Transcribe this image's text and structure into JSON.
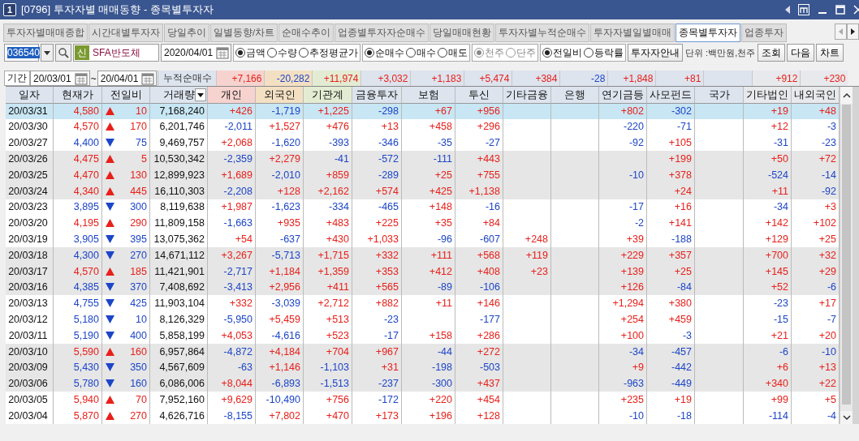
{
  "window": {
    "badge": "1",
    "title": "[0796] 투자자별 매매동향 - 종목별투자자"
  },
  "tabs": [
    {
      "label": "투자자별매매종합",
      "selected": false
    },
    {
      "label": "시간대별투자자",
      "selected": false
    },
    {
      "label": "당일추이",
      "selected": false
    },
    {
      "label": "일별동향/차트",
      "selected": false
    },
    {
      "label": "순매수추이",
      "selected": false
    },
    {
      "label": "업종별투자자순매수",
      "selected": false
    },
    {
      "label": "당일매매현황",
      "selected": false
    },
    {
      "label": "투자자별누적순매수",
      "selected": false
    },
    {
      "label": "투자자별일별매매",
      "selected": false
    },
    {
      "label": "종목별투자자",
      "selected": true
    },
    {
      "label": "업종투자",
      "selected": false
    }
  ],
  "toolbar": {
    "stock_code": {
      "value": "036540",
      "highlighted": true
    },
    "stock_badge": "신",
    "stock_name": "SFA반도체",
    "date": "2020/04/01",
    "option_groups": [
      {
        "disabled": false,
        "options": [
          {
            "label": "금액",
            "selected": true
          },
          {
            "label": "수량",
            "selected": false
          },
          {
            "label": "추정평균가",
            "selected": false
          }
        ]
      },
      {
        "disabled": false,
        "options": [
          {
            "label": "순매수",
            "selected": true
          },
          {
            "label": "매수",
            "selected": false
          },
          {
            "label": "매도",
            "selected": false
          }
        ]
      },
      {
        "disabled": true,
        "options": [
          {
            "label": "천주",
            "selected": true
          },
          {
            "label": "단주",
            "selected": false
          }
        ]
      },
      {
        "disabled": false,
        "options": [
          {
            "label": "전일비",
            "selected": true
          },
          {
            "label": "등락률",
            "selected": false
          }
        ]
      }
    ],
    "guide_button": "투자자안내",
    "unit_label": "단위 :백만원,천주",
    "buttons": [
      "조회",
      "다음",
      "차트"
    ]
  },
  "period": {
    "label": "기간",
    "from": "20/03/01",
    "separator": "~",
    "to": "20/04/01",
    "summary_label": "누적순매수",
    "totals": {
      "individual": "+7,166",
      "foreign": "-20,282",
      "institution": "+11,974",
      "financial_investment": "+3,032",
      "insurance": "+1,183",
      "investment_trust": "+5,474",
      "other_finance": "+384",
      "bank": "-28",
      "pension": "+1,848",
      "private_fund": "+81",
      "other_corporation": "+912",
      "foreign_resident": "+230"
    }
  },
  "table": {
    "columns": [
      {
        "label": "일자"
      },
      {
        "label": "현재가"
      },
      {
        "label": "전일비"
      },
      {
        "label": "거래량",
        "dropdown": true
      },
      {
        "label": "개인",
        "color": "#f6d3cf"
      },
      {
        "label": "외국인",
        "color": "#f3e0c3"
      },
      {
        "label": "기관계",
        "color": "#e3ecd2"
      },
      {
        "label": "금융투자",
        "color": "#dde4ee"
      },
      {
        "label": "보험",
        "color": "#dde4ee"
      },
      {
        "label": "투신",
        "color": "#dde4ee"
      },
      {
        "label": "기타금융",
        "color": "#dde4ee"
      },
      {
        "label": "은행",
        "color": "#dde4ee"
      },
      {
        "label": "연기금등",
        "color": "#dde4ee"
      },
      {
        "label": "사모펀드",
        "color": "#dde4ee"
      },
      {
        "label": "국가",
        "color": "#dde4ee"
      },
      {
        "label": "기타법인",
        "color": "#e8e9ec"
      },
      {
        "label": "내외국인",
        "color": "#e8e9ec"
      }
    ],
    "rows": [
      {
        "date": "20/03/31",
        "price": "4,580",
        "rising": true,
        "diff": "10",
        "volume": "7,168,240",
        "selected": true,
        "investors": {
          "individual": "+426",
          "foreign": "-1,719",
          "institution": "+1,225",
          "financial_investment": "-298",
          "insurance": "+67",
          "investment_trust": "+956",
          "pension": "+802",
          "private_fund": "-302",
          "other_corporation": "+19",
          "foreign_resident": "+48"
        }
      },
      {
        "date": "20/03/30",
        "price": "4,570",
        "rising": true,
        "diff": "170",
        "volume": "6,201,746",
        "selected": false,
        "investors": {
          "individual": "-2,011",
          "foreign": "+1,527",
          "institution": "+476",
          "financial_investment": "+13",
          "insurance": "+458",
          "investment_trust": "+296",
          "pension": "-220",
          "private_fund": "-71",
          "other_corporation": "+12",
          "foreign_resident": "-3"
        }
      },
      {
        "date": "20/03/27",
        "price": "4,400",
        "rising": false,
        "diff": "75",
        "volume": "9,469,757",
        "selected": false,
        "investors": {
          "individual": "+2,068",
          "foreign": "-1,620",
          "institution": "-393",
          "financial_investment": "-346",
          "insurance": "-35",
          "investment_trust": "-27",
          "pension": "-92",
          "private_fund": "+105",
          "other_corporation": "-31",
          "foreign_resident": "-23"
        }
      },
      {
        "date": "20/03/26",
        "price": "4,475",
        "rising": true,
        "diff": "5",
        "volume": "10,530,342",
        "selected": false,
        "investors": {
          "individual": "-2,359",
          "foreign": "+2,279",
          "institution": "-41",
          "financial_investment": "-572",
          "insurance": "-111",
          "investment_trust": "+443",
          "private_fund": "+199",
          "other_corporation": "+50",
          "foreign_resident": "+72"
        }
      },
      {
        "date": "20/03/25",
        "price": "4,470",
        "rising": true,
        "diff": "130",
        "volume": "12,899,923",
        "selected": false,
        "investors": {
          "individual": "+1,689",
          "foreign": "-2,010",
          "institution": "+859",
          "financial_investment": "-289",
          "insurance": "+25",
          "investment_trust": "+755",
          "pension": "-10",
          "private_fund": "+378",
          "other_corporation": "-524",
          "foreign_resident": "-14"
        }
      },
      {
        "date": "20/03/24",
        "price": "4,340",
        "rising": true,
        "diff": "445",
        "volume": "16,110,303",
        "selected": false,
        "investors": {
          "individual": "-2,208",
          "foreign": "+128",
          "institution": "+2,162",
          "financial_investment": "+574",
          "insurance": "+425",
          "investment_trust": "+1,138",
          "private_fund": "+24",
          "other_corporation": "+11",
          "foreign_resident": "-92"
        }
      },
      {
        "date": "20/03/23",
        "price": "3,895",
        "rising": false,
        "diff": "300",
        "volume": "8,119,638",
        "selected": false,
        "investors": {
          "individual": "+1,987",
          "foreign": "-1,623",
          "institution": "-334",
          "financial_investment": "-465",
          "insurance": "+148",
          "investment_trust": "-16",
          "pension": "-17",
          "private_fund": "+16",
          "other_corporation": "-34",
          "foreign_resident": "+3"
        }
      },
      {
        "date": "20/03/20",
        "price": "4,195",
        "rising": true,
        "diff": "290",
        "volume": "11,809,158",
        "selected": false,
        "investors": {
          "individual": "-1,663",
          "foreign": "+935",
          "institution": "+483",
          "financial_investment": "+225",
          "insurance": "+35",
          "investment_trust": "+84",
          "pension": "-2",
          "private_fund": "+141",
          "other_corporation": "+142",
          "foreign_resident": "+102"
        }
      },
      {
        "date": "20/03/19",
        "price": "3,905",
        "rising": false,
        "diff": "395",
        "volume": "13,075,362",
        "selected": false,
        "investors": {
          "individual": "+54",
          "foreign": "-637",
          "institution": "+430",
          "financial_investment": "+1,033",
          "insurance": "-96",
          "investment_trust": "-607",
          "other_finance": "+248",
          "pension": "+39",
          "private_fund": "-188",
          "other_corporation": "+129",
          "foreign_resident": "+25"
        }
      },
      {
        "date": "20/03/18",
        "price": "4,300",
        "rising": false,
        "diff": "270",
        "volume": "14,671,112",
        "selected": false,
        "investors": {
          "individual": "+3,267",
          "foreign": "-5,713",
          "institution": "+1,715",
          "financial_investment": "+332",
          "insurance": "+111",
          "investment_trust": "+568",
          "other_finance": "+119",
          "pension": "+229",
          "private_fund": "+357",
          "other_corporation": "+700",
          "foreign_resident": "+32"
        }
      },
      {
        "date": "20/03/17",
        "price": "4,570",
        "rising": true,
        "diff": "185",
        "volume": "11,421,901",
        "selected": false,
        "investors": {
          "individual": "-2,717",
          "foreign": "+1,184",
          "institution": "+1,359",
          "financial_investment": "+353",
          "insurance": "+412",
          "investment_trust": "+408",
          "other_finance": "+23",
          "pension": "+139",
          "private_fund": "+25",
          "other_corporation": "+145",
          "foreign_resident": "+29"
        }
      },
      {
        "date": "20/03/16",
        "price": "4,385",
        "rising": false,
        "diff": "370",
        "volume": "7,408,692",
        "selected": false,
        "investors": {
          "individual": "-3,413",
          "foreign": "+2,956",
          "institution": "+411",
          "financial_investment": "+565",
          "insurance": "-89",
          "investment_trust": "-106",
          "pension": "+126",
          "private_fund": "-84",
          "other_corporation": "+52",
          "foreign_resident": "-6"
        }
      },
      {
        "date": "20/03/13",
        "price": "4,755",
        "rising": false,
        "diff": "425",
        "volume": "11,903,104",
        "selected": false,
        "investors": {
          "individual": "+332",
          "foreign": "-3,039",
          "institution": "+2,712",
          "financial_investment": "+882",
          "insurance": "+11",
          "investment_trust": "+146",
          "pension": "+1,294",
          "private_fund": "+380",
          "other_corporation": "-23",
          "foreign_resident": "+17"
        }
      },
      {
        "date": "20/03/12",
        "price": "5,180",
        "rising": false,
        "diff": "10",
        "volume": "8,126,329",
        "selected": false,
        "investors": {
          "individual": "-5,950",
          "foreign": "+5,459",
          "institution": "+513",
          "financial_investment": "-23",
          "investment_trust": "-177",
          "pension": "+254",
          "private_fund": "+459",
          "other_corporation": "-15",
          "foreign_resident": "-7"
        }
      },
      {
        "date": "20/03/11",
        "price": "5,190",
        "rising": false,
        "diff": "400",
        "volume": "5,858,199",
        "selected": false,
        "investors": {
          "individual": "+4,053",
          "foreign": "-4,616",
          "institution": "+523",
          "financial_investment": "-17",
          "insurance": "+158",
          "investment_trust": "+286",
          "pension": "+100",
          "private_fund": "-3",
          "other_corporation": "+21",
          "foreign_resident": "+20"
        }
      },
      {
        "date": "20/03/10",
        "price": "5,590",
        "rising": true,
        "diff": "160",
        "volume": "6,957,864",
        "selected": false,
        "investors": {
          "individual": "-4,872",
          "foreign": "+4,184",
          "institution": "+704",
          "financial_investment": "+967",
          "insurance": "-44",
          "investment_trust": "+272",
          "pension": "-34",
          "private_fund": "-457",
          "other_corporation": "-6",
          "foreign_resident": "-10"
        }
      },
      {
        "date": "20/03/09",
        "price": "5,430",
        "rising": false,
        "diff": "350",
        "volume": "4,567,609",
        "selected": false,
        "investors": {
          "individual": "-63",
          "foreign": "+1,146",
          "institution": "-1,103",
          "financial_investment": "+31",
          "insurance": "-198",
          "investment_trust": "-503",
          "pension": "+9",
          "private_fund": "-442",
          "other_corporation": "+6",
          "foreign_resident": "+13"
        }
      },
      {
        "date": "20/03/06",
        "price": "5,780",
        "rising": false,
        "diff": "160",
        "volume": "6,086,006",
        "selected": false,
        "investors": {
          "individual": "+8,044",
          "foreign": "-6,893",
          "institution": "-1,513",
          "financial_investment": "-237",
          "insurance": "-300",
          "investment_trust": "+437",
          "pension": "-963",
          "private_fund": "-449",
          "other_corporation": "+340",
          "foreign_resident": "+22"
        }
      },
      {
        "date": "20/03/05",
        "price": "5,940",
        "rising": true,
        "diff": "70",
        "volume": "7,952,160",
        "selected": false,
        "investors": {
          "individual": "+9,629",
          "foreign": "-10,490",
          "institution": "+756",
          "financial_investment": "-172",
          "insurance": "+220",
          "investment_trust": "+454",
          "pension": "+235",
          "private_fund": "+19",
          "other_corporation": "+99",
          "foreign_resident": "+5"
        }
      },
      {
        "date": "20/03/04",
        "price": "5,870",
        "rising": true,
        "diff": "270",
        "volume": "4,626,716",
        "selected": false,
        "investors": {
          "individual": "-8,155",
          "foreign": "+7,802",
          "institution": "+470",
          "financial_investment": "+173",
          "insurance": "+196",
          "investment_trust": "+128",
          "pension": "-10",
          "private_fund": "-18",
          "other_corporation": "-114",
          "foreign_resident": "-4"
        }
      }
    ]
  }
}
